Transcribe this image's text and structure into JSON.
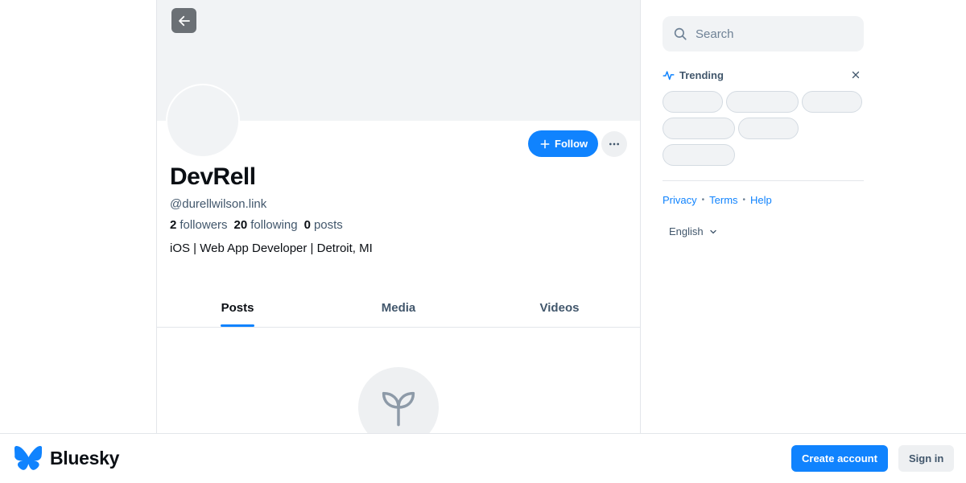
{
  "profile": {
    "display_name": "DevRell",
    "handle": "@durellwilson.link",
    "followers_count": "2",
    "followers_label": "followers",
    "following_count": "20",
    "following_label": "following",
    "posts_count": "0",
    "posts_label": "posts",
    "bio": "iOS | Web App Developer | Detroit, MI"
  },
  "actions": {
    "follow_label": "Follow"
  },
  "tabs": [
    {
      "label": "Posts",
      "active": true
    },
    {
      "label": "Media",
      "active": false
    },
    {
      "label": "Videos",
      "active": false
    }
  ],
  "sidebar": {
    "search_placeholder": "Search",
    "trending_title": "Trending",
    "footer_links": [
      "Privacy",
      "Terms",
      "Help"
    ],
    "language": "English"
  },
  "bottom_bar": {
    "brand": "Bluesky",
    "create_account_label": "Create account",
    "sign_in_label": "Sign in"
  },
  "icons": {
    "back": "arrow-left-icon",
    "follow": "plus-icon",
    "more": "ellipsis-icon",
    "empty_posts": "seedling-icon",
    "search": "search-icon",
    "trending": "pulse-icon",
    "close": "close-icon",
    "language": "chevron-down-icon",
    "brand": "butterfly-logo-icon"
  },
  "colors": {
    "accent": "#1083fe",
    "text_secondary": "#42576c",
    "surface": "#f1f3f5"
  }
}
